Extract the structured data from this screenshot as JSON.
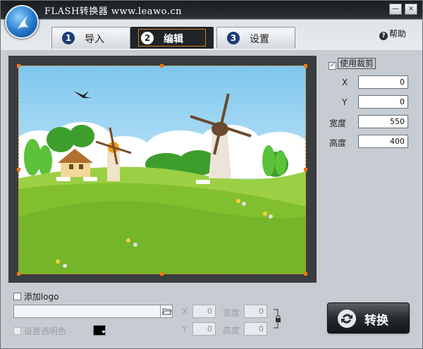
{
  "app": {
    "title": "FLASH转换器 www.leawo.cn",
    "minimize": "—",
    "close": "×"
  },
  "tabs": [
    {
      "num": "1",
      "label": "导入",
      "active": false
    },
    {
      "num": "2",
      "label": "编辑",
      "active": true
    },
    {
      "num": "3",
      "label": "设置",
      "active": false
    }
  ],
  "help": {
    "label": "帮助",
    "icon": "?"
  },
  "crop": {
    "enabled_label": "使用裁剪",
    "checked": true,
    "check_mark": "✓",
    "x_label": "X",
    "x_value": "0",
    "y_label": "Y",
    "y_value": "0",
    "width_label": "宽度",
    "width_value": "550",
    "height_label": "高度",
    "height_value": "400"
  },
  "logo": {
    "add_label": "添加logo",
    "path_value": "",
    "x_label": "X",
    "x_value": "0",
    "y_label": "Y",
    "y_value": "0",
    "width_label": "宽度",
    "width_value": "0",
    "height_label": "高度",
    "height_value": "0",
    "transparent_label": "设置透明色",
    "transparent_color": "#000000"
  },
  "convert": {
    "label": "转换"
  },
  "colors": {
    "accent": "#e0892a",
    "dark_tab": "#1f2427",
    "tab_num": "#1c3c78"
  }
}
